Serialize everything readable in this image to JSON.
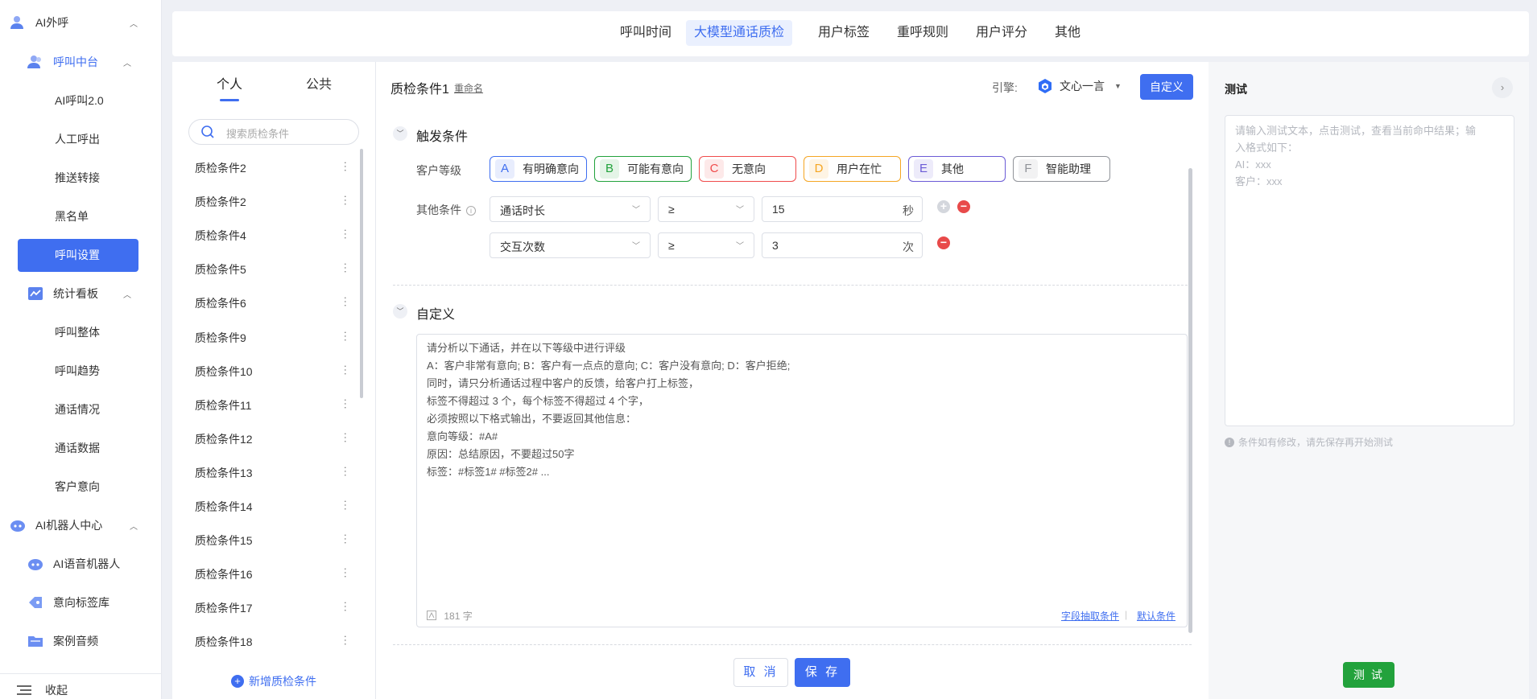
{
  "nav": {
    "ai_outbound": "AI外呼",
    "call_center": "呼叫中台",
    "sub_call": [
      "AI呼叫2.0",
      "人工呼出",
      "推送转接",
      "黑名单",
      "呼叫设置"
    ],
    "stats_board": "统计看板",
    "sub_stats": [
      "呼叫整体",
      "呼叫趋势",
      "通话情况",
      "通话数据",
      "客户意向"
    ],
    "robot_center": "AI机器人中心",
    "sub_robot": [
      "AI语音机器人",
      "意向标签库",
      "案例音频"
    ],
    "collapse": "收起"
  },
  "tabs": [
    "呼叫时间",
    "大模型通话质检",
    "用户标签",
    "重呼规则",
    "用户评分",
    "其他"
  ],
  "list": {
    "seg_personal": "个人",
    "seg_public": "公共",
    "search_placeholder": "搜索质检条件",
    "items": [
      "质检条件2",
      "质检条件2",
      "质检条件4",
      "质检条件5",
      "质检条件6",
      "质检条件9",
      "质检条件10",
      "质检条件11",
      "质检条件12",
      "质检条件13",
      "质检条件14",
      "质检条件15",
      "质检条件16",
      "质检条件17",
      "质检条件18"
    ],
    "add_label": "新增质检条件"
  },
  "editor": {
    "title": "质检条件1",
    "rename": "重命名",
    "engine_label": "引擎:",
    "engine_value": "文心一言",
    "custom_btn": "自定义",
    "trigger_title": "触发条件",
    "customer_level_label": "客户等级",
    "levels": [
      {
        "letter": "A",
        "text": "有明确意向",
        "color": "#3f6ef0"
      },
      {
        "letter": "B",
        "text": "可能有意向",
        "color": "#22a23c"
      },
      {
        "letter": "C",
        "text": "无意向",
        "color": "#f04b4b"
      },
      {
        "letter": "D",
        "text": "用户在忙",
        "color": "#f5a623"
      },
      {
        "letter": "E",
        "text": "其他",
        "color": "#6b5bd6"
      },
      {
        "letter": "F",
        "text": "智能助理",
        "color": "#909399"
      }
    ],
    "other_cond_label": "其他条件",
    "rules": [
      {
        "field": "通话时长",
        "op": "≥",
        "value": "15",
        "unit": "秒"
      },
      {
        "field": "交互次数",
        "op": "≥",
        "value": "3",
        "unit": "次"
      }
    ],
    "custom_title": "自定义",
    "prompt_lines": [
      "请分析以下通话，并在以下等级中进行评级",
      "A：客户非常有意向; B：客户有一点点的意向; C：客户没有意向; D：客户拒绝;",
      "同时，请只分析通话过程中客户的反馈，给客户打上标签，",
      "标签不得超过 3 个，每个标签不得超过 4 个字，",
      "必须按照以下格式输出，不要返回其他信息：",
      "意向等级：#A#",
      "原因：总结原因，不要超过50字",
      " 标签：#标签1# #标签2# ..."
    ],
    "word_count": "181 字",
    "link_extract": "字段抽取条件",
    "link_default": "默认条件",
    "cancel": "取 消",
    "save": "保 存"
  },
  "test": {
    "title": "测试",
    "placeholder_lines": [
      "请输入测试文本，点击测试，查看当前命中结果；输",
      "入格式如下：",
      "AI：xxx",
      "客户：xxx"
    ],
    "hint": "条件如有修改，请先保存再开始测试",
    "button": "测 试"
  }
}
